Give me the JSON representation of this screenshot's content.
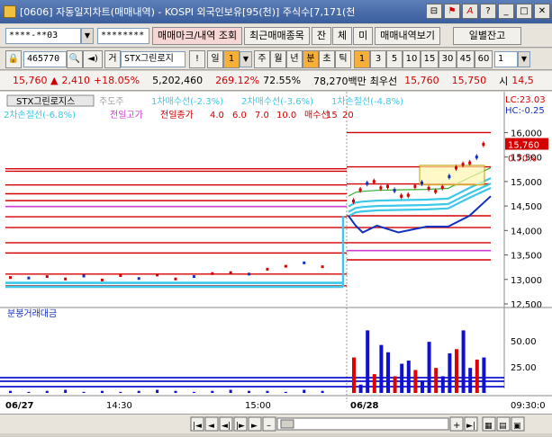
{
  "window": {
    "title": "[0606] 자동일지차트(매매내역) - KOSPI 외국인보유[95(천)] 주식수[7,171(천"
  },
  "toolbar1": {
    "account_value": "****-**03",
    "password_value": "********",
    "btn_trade_mark": "매매마크/내역 조회",
    "btn_recent_items": "최근매매종목",
    "btn_balance": "잔",
    "btn_execution": "체",
    "btn_unexecuted": "미",
    "btn_trade_history": "매매내역보기",
    "btn_daily_balance": "일별잔고"
  },
  "toolbar2": {
    "code_value": "465770",
    "prefix": "거",
    "name_value": "STX그린로지",
    "excl": "!",
    "period_day": "일",
    "day_count": "1",
    "period_week": "주",
    "period_month": "월",
    "period_year": "년",
    "period_min": "분",
    "period_tick": "초",
    "period_t": "틱",
    "min_options": [
      "1",
      "3",
      "5",
      "10",
      "15",
      "30",
      "45",
      "60"
    ],
    "min_count": "1"
  },
  "quote": {
    "price": "15,760",
    "arrow": "▲",
    "change": "2,410",
    "change_pct": "+18.05%",
    "volume": "5,202,460",
    "vol_ratio": "269.12%",
    "rate2": "72.55%",
    "amount": "78,270백만",
    "best_bid_label": "최우선",
    "best_ask": "15,760",
    "best_bid": "15,750",
    "open_label": "시",
    "open_value": "14,5"
  },
  "legend": {
    "name": "STX그린로지스",
    "main_label": "주도주",
    "l1": "1차매수선(-2.3%)",
    "l2": "2차매수선(-3.6%)",
    "l3": "1차손절선(-4.8%)",
    "l4": "2차손절선(-6.8%)",
    "l5": "전일고가",
    "l6": "전일종가",
    "l7": "4.0",
    "l8": "6.0",
    "l9": "7.0",
    "l10": "10.0",
    "l11": "매수선",
    "l12": "15",
    "l13": "20"
  },
  "right_labels": {
    "lc": "LC:23.03",
    "hc": "HC:-0.25",
    "price_tag": "15,760",
    "pct_tag": "0.70%"
  },
  "volume_panel": {
    "title": "분봉거래대금"
  },
  "bottom_axis": {
    "d1": "06/27",
    "t1": "14:30",
    "t2": "15:00",
    "d2": "06/28",
    "t3": "09:30:0"
  },
  "colors": {
    "red_line": "#d40000",
    "cyan_line": "#3cc8e8",
    "magenta_line": "#d040d0",
    "blue_line": "#1030c0",
    "green_line": "#30b030",
    "volume_bar": "#1010d0",
    "volume_bar_red": "#e00000"
  },
  "chart_data": {
    "type": "line",
    "ylim": [
      12500,
      16100
    ],
    "yticks": [
      "16,000",
      "15,500",
      "15,000",
      "14,500",
      "14,000",
      "13,500",
      "13,000",
      "12,500"
    ],
    "vol_yticks": [
      "50.00",
      "25.00"
    ],
    "vol_ylim": [
      0,
      75
    ],
    "series_red_levels": [
      15260,
      15210,
      14930,
      14750,
      14610,
      14280,
      14060,
      13750,
      13540,
      13110,
      12870
    ],
    "series_red_levels_after": [
      16000,
      15300,
      14950,
      14300,
      14060,
      13750,
      13400
    ],
    "magenta_level": 14490,
    "magenta_after": 13590,
    "cyan_before": [
      12930,
      12850
    ],
    "cyan_after_x": [
      0.0,
      0.05,
      0.1,
      0.2,
      0.35,
      0.55,
      0.7,
      0.85,
      1.0
    ],
    "cyan_after_y": [
      14520,
      14600,
      14620,
      14640,
      14650,
      14660,
      14680,
      14900,
      15100
    ],
    "blue_after_y": [
      14300,
      14100,
      13960,
      14100,
      13960,
      14080,
      14080,
      14300,
      14700
    ],
    "price_before": [
      13030,
      13020,
      13050,
      13000,
      13060,
      12980,
      13070,
      13010,
      13080,
      13000,
      13050,
      13110,
      13130,
      13100,
      13200,
      13260,
      13330,
      13250
    ],
    "price_after": [
      14600,
      14830,
      14960,
      15000,
      14870,
      14900,
      14820,
      14700,
      14720,
      14900,
      14970,
      14860,
      14800,
      14880,
      15100,
      15280,
      15350,
      15380,
      15500,
      15760
    ],
    "vol_before": [
      2,
      1,
      2,
      3,
      1,
      2,
      1,
      2,
      3,
      2,
      1,
      2,
      3,
      2,
      2,
      1,
      3,
      2
    ],
    "vol_after": [
      34,
      8,
      60,
      18,
      46,
      39,
      16,
      28,
      31,
      22,
      12,
      49,
      24,
      16,
      38,
      42,
      60,
      24,
      32,
      34
    ]
  }
}
